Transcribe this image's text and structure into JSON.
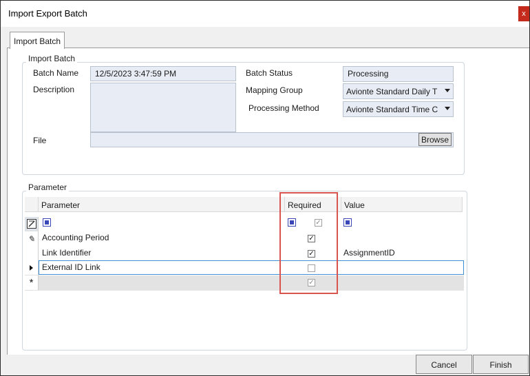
{
  "window": {
    "title": "Import Export Batch",
    "close_label": "x"
  },
  "tabs": [
    "Import Batch"
  ],
  "import_batch": {
    "group_label": "Import Batch",
    "batch_name_label": "Batch Name",
    "batch_name_value": "12/5/2023 3:47:59 PM",
    "description_label": "Description",
    "description_value": "",
    "batch_status_label": "Batch Status",
    "batch_status_value": "Processing",
    "mapping_group_label": "Mapping Group",
    "mapping_group_value": "Avionte Standard Daily T",
    "processing_method_label": "Processing Method",
    "processing_method_value": "Avionte Standard Time C",
    "file_label": "File",
    "file_value": "",
    "browse_label": "Browse"
  },
  "parameters": {
    "group_label": "Parameter",
    "columns": [
      "Parameter",
      "Required",
      "Value"
    ],
    "rows": [
      {
        "parameter": "Accounting Period",
        "required": true,
        "value": ""
      },
      {
        "parameter": "Link Identifier",
        "required": true,
        "value": "AssignmentID"
      },
      {
        "parameter": "External ID Link",
        "required": false,
        "value": ""
      }
    ],
    "new_row_glyph": "*"
  },
  "buttons": {
    "cancel": "Cancel",
    "finish": "Finish"
  },
  "colors": {
    "highlight": "#d9534f",
    "field_bg": "#e8edf5",
    "filter_icon": "#3b46b8",
    "selected_row_border": "#3d8fd6"
  }
}
